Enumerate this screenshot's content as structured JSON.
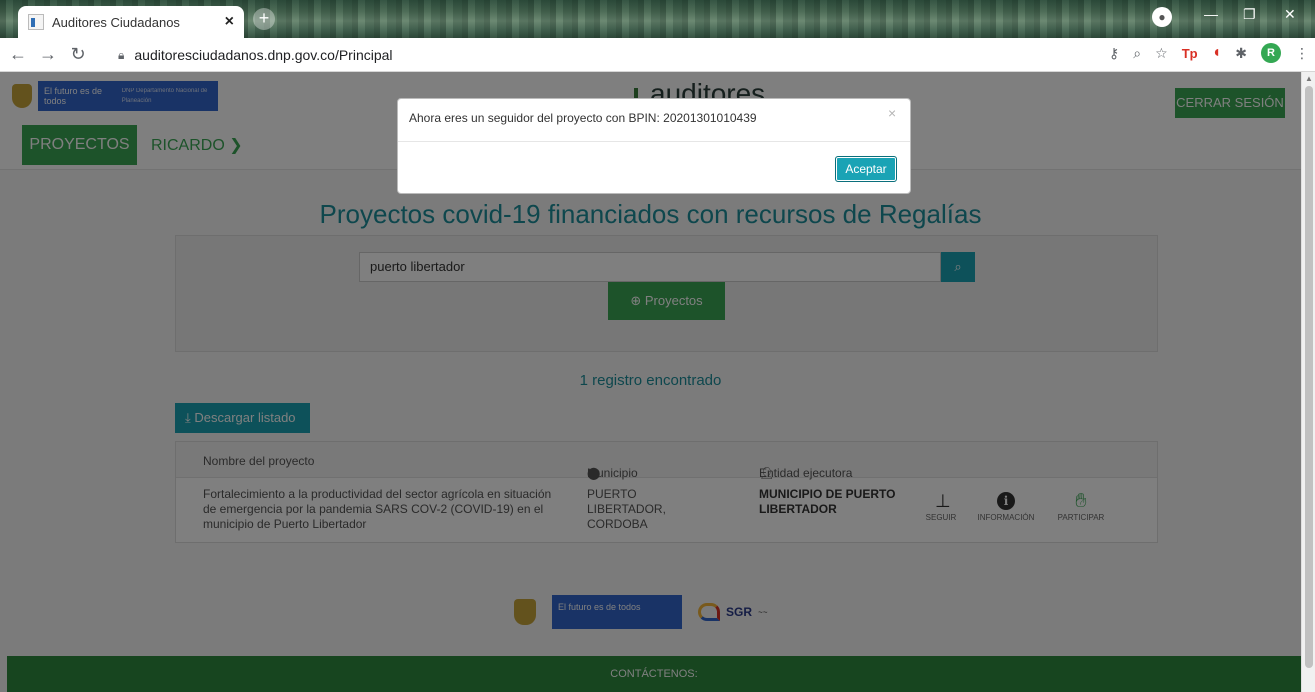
{
  "browser": {
    "tab_title": "Auditores Ciudadanos",
    "tab_close": "×",
    "new_tab": "+",
    "url": "auditoresciudadanos.dnp.gov.co/Principal",
    "profile_initial": "R",
    "ext_tp": "Tp"
  },
  "header": {
    "gov_text": "El futuro es de todos",
    "gov_sub": "DNP Departamento Nacional de Planeación",
    "brand": "auditores",
    "logout_label": "CERRAR SESIÓN"
  },
  "nav": {
    "projects_label": "PROYECTOS",
    "user_label": "RICARDO"
  },
  "main": {
    "title": "Proyectos covid-19 financiados con recursos de Regalías",
    "search_value": "puerto libertador",
    "projects_button": "Proyectos",
    "records_found": "1 registro encontrado",
    "download_label": "Descargar listado"
  },
  "table": {
    "headers": {
      "name": "Nombre del proyecto",
      "municipality": "Municipio",
      "entity": "Entidad ejecutora"
    },
    "rows": [
      {
        "name": "Fortalecimiento a la productividad del sector agrícola en situación de emergencia por la pandemia SARS COV-2 (COVID-19) en el municipio de Puerto Libertador",
        "municipality": "PUERTO LIBERTADOR, CORDOBA",
        "entity": "MUNICIPIO DE PUERTO LIBERTADOR",
        "actions": {
          "follow": "SEGUIR",
          "info": "INFORMACIÓN",
          "participate": "PARTICIPAR"
        }
      }
    ]
  },
  "footer": {
    "gov_text": "El futuro es de todos",
    "sgr": "SGR",
    "contact": "CONTÁCTENOS:"
  },
  "modal": {
    "message": "Ahora eres un seguidor del proyecto con BPIN: 20201301010439",
    "close": "×",
    "ok_label": "Aceptar"
  }
}
